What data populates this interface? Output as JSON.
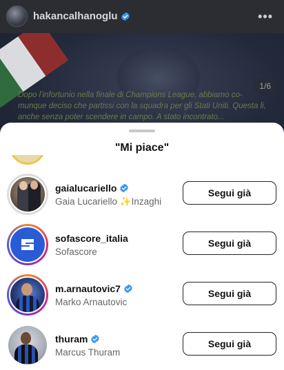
{
  "post": {
    "username": "hakancalhanoglu",
    "more_icon": "more-horizontal-icon",
    "page_counter": "1/6",
    "caption": "Dopo l'infortunio nella finale di Champions League, abbiamo co-munque deciso che partissi con la squadra per gli Stati Uniti. Questa li, anche senza poter scendere in campo. A stato incontrato..."
  },
  "sheet": {
    "title": "\"Mi piace\"",
    "likers": [
      {
        "username": "gaialucariello",
        "verified": true,
        "full_name": "Gaia Lucariello ✨Inzaghi",
        "button_label": "Segui già",
        "ring": "gray"
      },
      {
        "username": "sofascore_italia",
        "verified": false,
        "full_name": "Sofascore",
        "button_label": "Segui già",
        "ring": "story"
      },
      {
        "username": "m.arnautovic7",
        "verified": true,
        "full_name": "Marko Arnautovic",
        "button_label": "Segui già",
        "ring": "story"
      },
      {
        "username": "thuram",
        "verified": true,
        "full_name": "Marcus Thuram",
        "button_label": "Segui già",
        "ring": "none"
      }
    ]
  },
  "colors": {
    "verified_blue": "#3897f0",
    "sofascore_blue": "#2a5bd7",
    "text_primary": "#111111",
    "text_secondary": "#666666"
  }
}
